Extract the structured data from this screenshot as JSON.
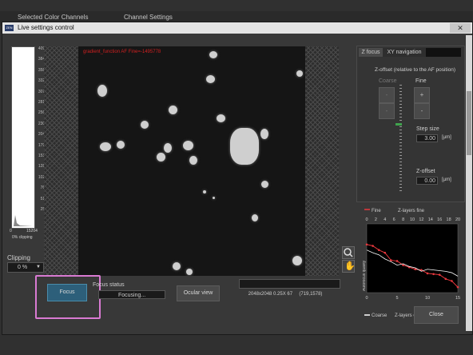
{
  "background": {
    "selected_color_channels": "Selected Color Channels",
    "channel_settings": "Channel Settings"
  },
  "window": {
    "title": "Live settings control",
    "icon_text": "ZEN"
  },
  "histogram": {
    "ticks": [
      "4096",
      "3840",
      "3584",
      "3328",
      "3072",
      "2816",
      "2560",
      "2304",
      "2048",
      "1792",
      "1536",
      "1280",
      "1024",
      "768",
      "512",
      "256"
    ],
    "min_label": "0",
    "max_label": "15204",
    "clipping_label": "0% clipping"
  },
  "clipping": {
    "label": "Clipping",
    "value": "0 %"
  },
  "image": {
    "overlay_text": "gradient_function AF Fine=-1495778"
  },
  "focus": {
    "button_label": "Focus",
    "status_label": "Focus status",
    "status_value": "Focusing...",
    "ocular_label": "Ocular view",
    "image_info": "2048x2048 0.25X 67     (719,1578)"
  },
  "zfocus": {
    "tabs": [
      "Z focus",
      "XY navigation"
    ],
    "offset_title": "Z-offset (relative to the AF position)",
    "coarse_label": "Coarse",
    "fine_label": "Fine",
    "plus": "+",
    "minus": "-",
    "step_label": "Step size",
    "step_value": "3.00",
    "step_unit": "[µm]",
    "zoffset_label": "Z-offset",
    "zoffset_value": "0.00",
    "zoffset_unit": "[µm]"
  },
  "close_label": "Close",
  "chart_data": {
    "type": "line",
    "title": "Z-layers fine",
    "xlabel": "Z-layers coarse",
    "ylabel": "Autofocus quality",
    "x_top": [
      0,
      2,
      4,
      6,
      8,
      10,
      12,
      14,
      16,
      18,
      20
    ],
    "x_bottom": [
      0,
      5,
      10,
      15
    ],
    "legend": [
      "Fine",
      "Coarse"
    ],
    "colors": {
      "fine": "#e8383d",
      "coarse": "#ffffff"
    },
    "series": [
      {
        "name": "Fine",
        "x": [
          0,
          1,
          2,
          3,
          4,
          5,
          6,
          7,
          8,
          9,
          10,
          11,
          12,
          13,
          14,
          15
        ],
        "y": [
          0.7,
          0.68,
          0.62,
          0.58,
          0.47,
          0.46,
          0.4,
          0.37,
          0.34,
          0.33,
          0.28,
          0.27,
          0.26,
          0.2,
          0.17,
          0.08
        ]
      },
      {
        "name": "Coarse",
        "x": [
          0,
          1,
          2,
          3,
          4,
          5,
          6,
          7,
          8,
          9,
          10,
          11,
          12,
          13,
          14,
          15
        ],
        "y": [
          0.62,
          0.58,
          0.55,
          0.49,
          0.45,
          0.4,
          0.42,
          0.38,
          0.36,
          0.31,
          0.34,
          0.33,
          0.32,
          0.31,
          0.29,
          0.24
        ]
      }
    ]
  }
}
